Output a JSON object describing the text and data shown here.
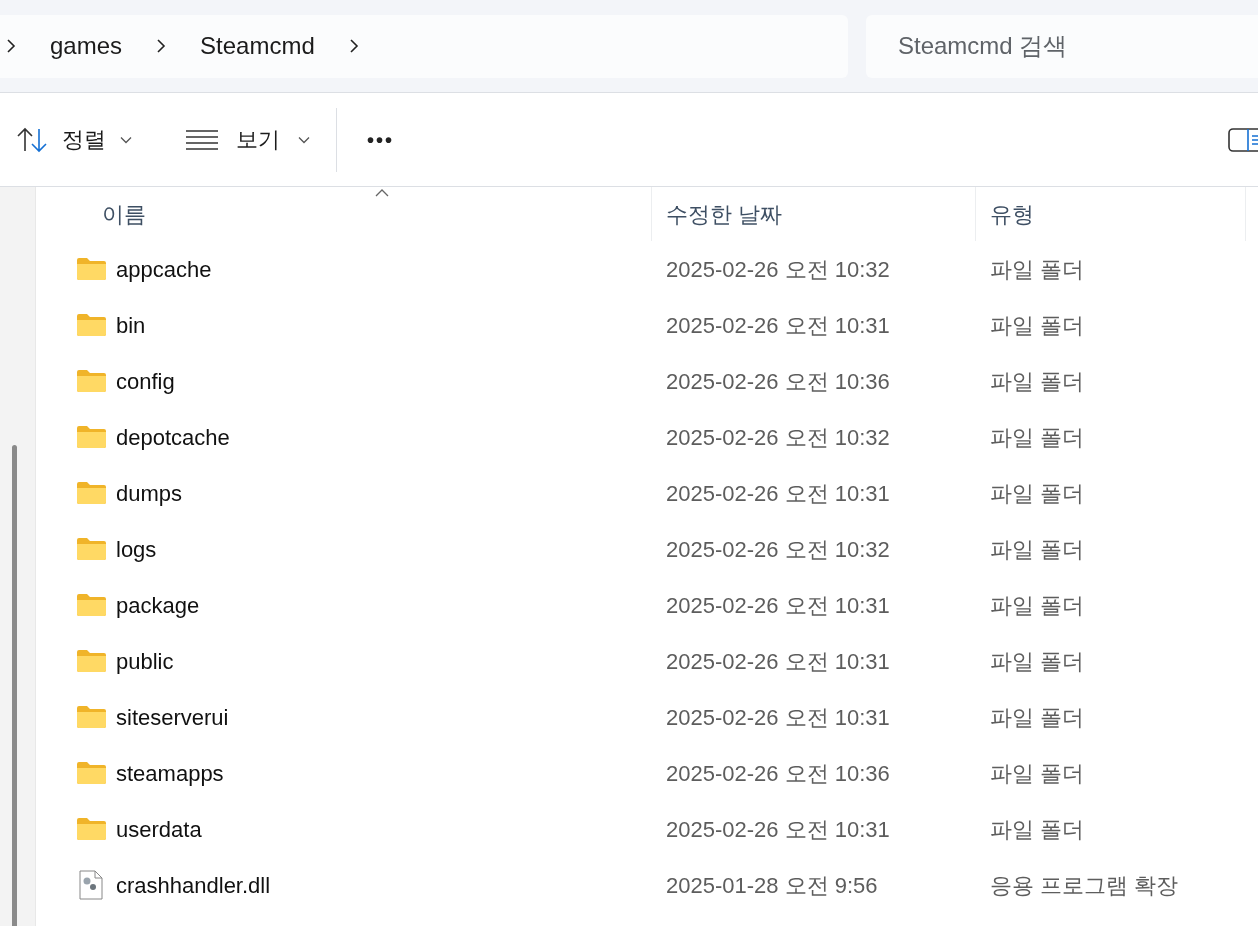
{
  "breadcrumb": [
    "games",
    "Steamcmd"
  ],
  "search": {
    "placeholder": "Steamcmd 검색"
  },
  "toolbar": {
    "sort_label": "정렬",
    "view_label": "보기",
    "more_label": "•••"
  },
  "table": {
    "columns": [
      {
        "label": "이름",
        "sorted": true
      },
      {
        "label": "수정한 날짜",
        "sorted": false
      },
      {
        "label": "유형",
        "sorted": false
      }
    ],
    "rows": [
      {
        "kind": "folder",
        "name": "appcache",
        "date": "2025-02-26 오전 10:32",
        "type": "파일 폴더"
      },
      {
        "kind": "folder",
        "name": "bin",
        "date": "2025-02-26 오전 10:31",
        "type": "파일 폴더"
      },
      {
        "kind": "folder",
        "name": "config",
        "date": "2025-02-26 오전 10:36",
        "type": "파일 폴더"
      },
      {
        "kind": "folder",
        "name": "depotcache",
        "date": "2025-02-26 오전 10:32",
        "type": "파일 폴더"
      },
      {
        "kind": "folder",
        "name": "dumps",
        "date": "2025-02-26 오전 10:31",
        "type": "파일 폴더"
      },
      {
        "kind": "folder",
        "name": "logs",
        "date": "2025-02-26 오전 10:32",
        "type": "파일 폴더"
      },
      {
        "kind": "folder",
        "name": "package",
        "date": "2025-02-26 오전 10:31",
        "type": "파일 폴더"
      },
      {
        "kind": "folder",
        "name": "public",
        "date": "2025-02-26 오전 10:31",
        "type": "파일 폴더"
      },
      {
        "kind": "folder",
        "name": "siteserverui",
        "date": "2025-02-26 오전 10:31",
        "type": "파일 폴더"
      },
      {
        "kind": "folder",
        "name": "steamapps",
        "date": "2025-02-26 오전 10:36",
        "type": "파일 폴더"
      },
      {
        "kind": "folder",
        "name": "userdata",
        "date": "2025-02-26 오전 10:31",
        "type": "파일 폴더"
      },
      {
        "kind": "file",
        "name": "crashhandler.dll",
        "date": "2025-01-28 오전 9:56",
        "type": "응용 프로그램 확장"
      }
    ]
  }
}
